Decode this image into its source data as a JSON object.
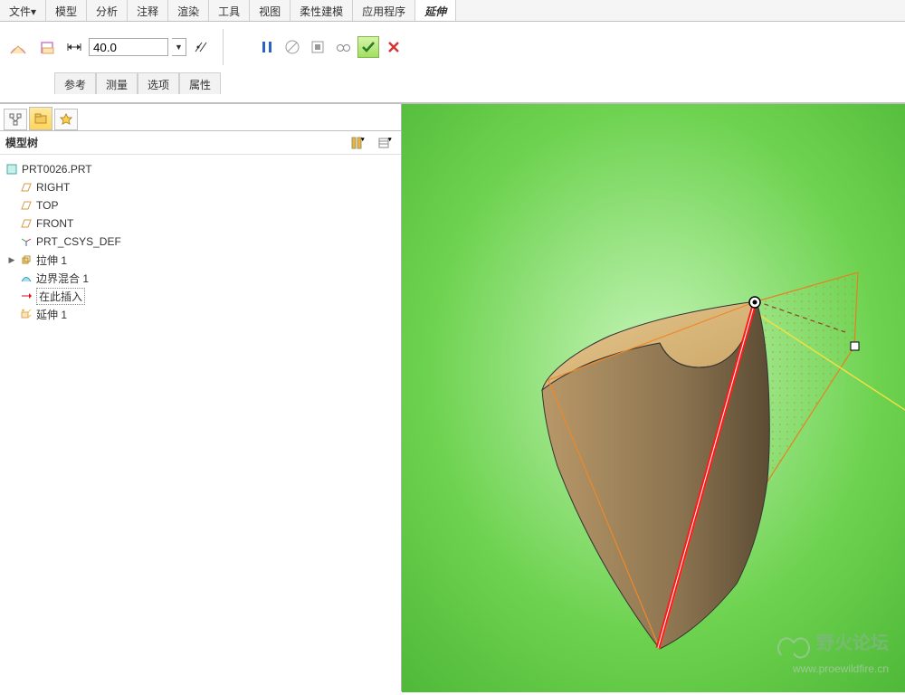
{
  "menu": {
    "file": "文件▾",
    "items": [
      "模型",
      "分析",
      "注释",
      "渲染",
      "工具",
      "视图",
      "柔性建模",
      "应用程序"
    ],
    "active": "延伸"
  },
  "ribbon": {
    "value": "40.0",
    "subtabs": [
      "参考",
      "测量",
      "选项",
      "属性"
    ]
  },
  "tree": {
    "title": "模型树",
    "root": "PRT0026.PRT",
    "nodes": {
      "right": "RIGHT",
      "top": "TOP",
      "front": "FRONT",
      "csys": "PRT_CSYS_DEF",
      "extrude": "拉伸 1",
      "blend": "边界混合 1",
      "insert": "在此插入",
      "extend": "延伸 1"
    }
  },
  "watermark": {
    "line1": "野火论坛",
    "line2": "www.proewildfire.cn"
  }
}
